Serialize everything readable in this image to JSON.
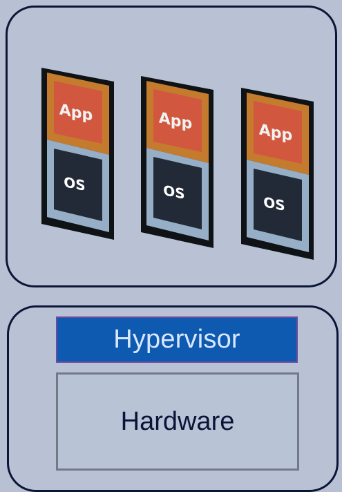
{
  "diagram": {
    "vm_stacks": [
      {
        "app_label": "App",
        "os_label": "OS"
      },
      {
        "app_label": "App",
        "os_label": "OS"
      },
      {
        "app_label": "App",
        "os_label": "OS"
      }
    ],
    "layers": {
      "hypervisor_label": "Hypervisor",
      "hardware_label": "Hardware"
    }
  }
}
